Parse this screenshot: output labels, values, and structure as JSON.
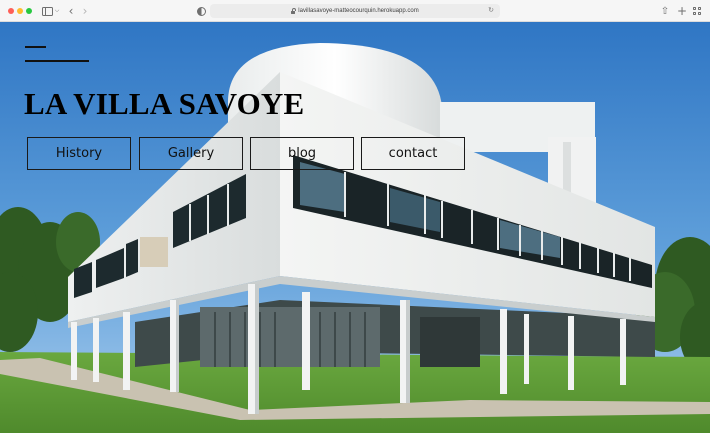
{
  "browser": {
    "url": "lavillasavoye-matteocourquin.herokuapp.com",
    "icons": {
      "sidebar": "sidebar-icon",
      "back": "chevron-left-icon",
      "forward": "chevron-right-icon",
      "privacy": "privacy-shield-icon",
      "reload": "reload-icon",
      "share": "share-icon",
      "new_tab": "plus-icon",
      "tab_overview": "tab-overview-icon"
    }
  },
  "site": {
    "title": "LA VILLA SAVOYE",
    "nav": [
      {
        "label": "History"
      },
      {
        "label": "Gallery"
      },
      {
        "label": "blog"
      },
      {
        "label": "contact"
      }
    ]
  },
  "colors": {
    "sky": "#3f86cf",
    "grass": "#5e9d37",
    "text": "#000000"
  }
}
